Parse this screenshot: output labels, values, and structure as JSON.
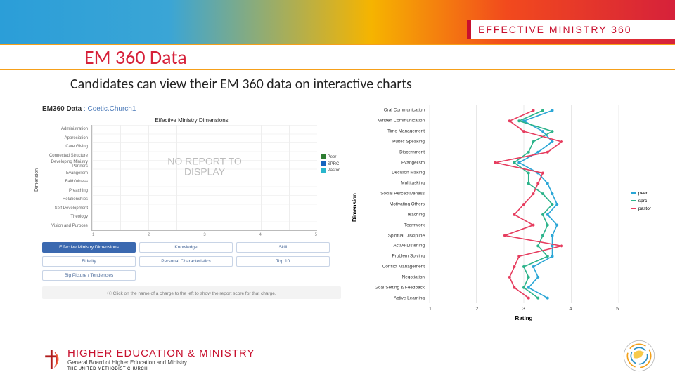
{
  "brand": "EFFECTIVE MINISTRY 360",
  "title": "EM 360 Data",
  "subtitle": "Candidates can view their EM 360 data on interactive charts",
  "left_panel": {
    "header_prefix": "EM360 Data",
    "header_context": "Coetic.Church1",
    "chart_title": "Effective Ministry Dimensions",
    "y_axis_label": "Dimension",
    "y_categories": [
      "Administration",
      "Appreciation",
      "Care Giving",
      "Connected Structure",
      "Developing Ministry Partners",
      "Evangelism",
      "Faithfulness",
      "Preaching",
      "Relationships",
      "Self Development",
      "Theology",
      "Vision and Purpose"
    ],
    "x_ticks": [
      "1",
      "2",
      "3",
      "4",
      "5"
    ],
    "no_report": "NO REPORT TO DISPLAY",
    "legend": [
      {
        "label": "Peer",
        "color": "#2e7d32"
      },
      {
        "label": "SPRC",
        "color": "#1565c0"
      },
      {
        "label": "Pastor",
        "color": "#29b6cc"
      }
    ],
    "tabs": [
      {
        "label": "Effective Ministry Dimensions",
        "active": true
      },
      {
        "label": "Knowledge"
      },
      {
        "label": "Skill"
      },
      {
        "label": "Fidelity"
      },
      {
        "label": "Personal Characteristics"
      },
      {
        "label": "Top 10"
      },
      {
        "label": "Big Picture / Tendencies"
      }
    ],
    "hint": "Click on the name of a charge to the left to show the report score for that charge."
  },
  "chart_data": {
    "type": "line",
    "orientation": "horizontal-categories",
    "title": "",
    "xlabel": "Rating",
    "ylabel": "Dimension",
    "xlim": [
      1,
      5
    ],
    "x_ticks": [
      1,
      2,
      3,
      4,
      5
    ],
    "categories": [
      "Oral Communication",
      "Written Communication",
      "Time Management",
      "Public Speaking",
      "Discernment",
      "Evangelism",
      "Decision Making",
      "Multitasking",
      "Social Perceptiveness",
      "Motivating Others",
      "Teaching",
      "Teamwork",
      "Spiritual Discipline",
      "Active Listening",
      "Problem Solving",
      "Conflict Management",
      "Negotiation",
      "Goal Setting & Feedback",
      "Active Learning"
    ],
    "series": [
      {
        "name": "peer",
        "color": "#2aa6d6",
        "values": [
          3.6,
          3.0,
          3.4,
          3.6,
          3.3,
          2.9,
          3.3,
          3.5,
          3.6,
          3.7,
          3.5,
          3.7,
          3.6,
          3.6,
          3.6,
          3.2,
          3.3,
          3.1,
          3.5
        ]
      },
      {
        "name": "sprc",
        "color": "#2bb38a",
        "values": [
          3.4,
          2.9,
          3.6,
          3.2,
          3.1,
          2.8,
          3.1,
          3.1,
          3.4,
          3.6,
          3.4,
          3.5,
          3.4,
          3.3,
          3.5,
          3.0,
          3.1,
          3.0,
          3.3
        ]
      },
      {
        "name": "pastor",
        "color": "#e63c5e",
        "values": [
          3.2,
          2.7,
          3.0,
          3.8,
          3.5,
          2.4,
          3.4,
          3.3,
          3.2,
          3.0,
          2.8,
          3.2,
          2.6,
          3.8,
          2.9,
          2.8,
          2.7,
          2.8,
          3.1
        ]
      }
    ],
    "legend_position": "right"
  },
  "footer": {
    "org_main": "HIGHER EDUCATION & MINISTRY",
    "org_sub": "General Board of Higher Education and Ministry",
    "org_church": "THE UNITED METHODIST CHURCH"
  }
}
